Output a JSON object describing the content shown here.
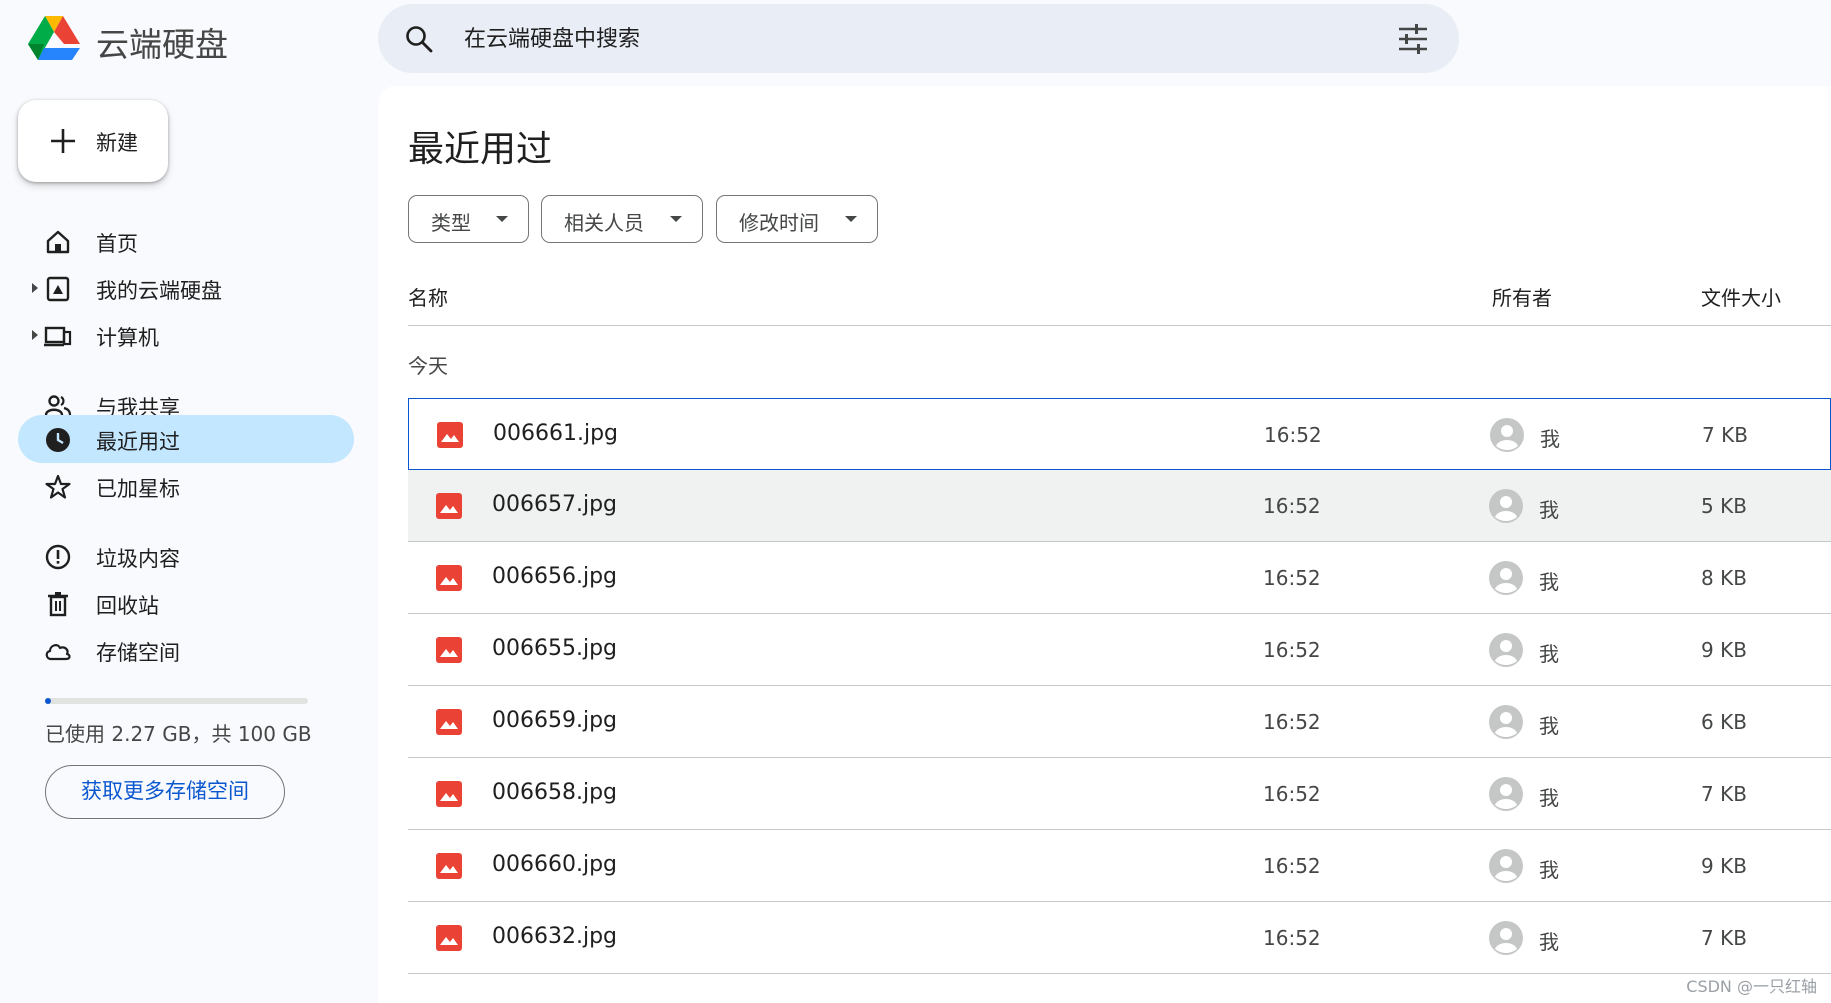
{
  "app": {
    "title": "云端硬盘"
  },
  "search": {
    "placeholder": "在云端硬盘中搜索"
  },
  "new_button": {
    "label": "新建"
  },
  "sidebar": {
    "items": [
      {
        "label": "首页",
        "icon": "home-icon"
      },
      {
        "label": "我的云端硬盘",
        "icon": "my-drive-icon"
      },
      {
        "label": "计算机",
        "icon": "computer-icon"
      },
      {
        "label": "与我共享",
        "icon": "people-icon"
      },
      {
        "label": "最近用过",
        "icon": "clock-icon",
        "active": true
      },
      {
        "label": "已加星标",
        "icon": "star-icon"
      },
      {
        "label": "垃圾内容",
        "icon": "spam-icon"
      },
      {
        "label": "回收站",
        "icon": "trash-icon"
      },
      {
        "label": "存储空间",
        "icon": "cloud-icon"
      }
    ],
    "storage": {
      "used_text": "已使用 2.27 GB，共 100 GB",
      "fraction": 0.0227,
      "button": "获取更多存储空间"
    }
  },
  "main": {
    "title": "最近用过",
    "filters": [
      "类型",
      "相关人员",
      "修改时间"
    ],
    "columns": {
      "name": "名称",
      "owner": "所有者",
      "size": "文件大小"
    },
    "group": "今天",
    "files": [
      {
        "name": "006661.jpg",
        "time": "16:52",
        "owner": "我",
        "size": "7 KB"
      },
      {
        "name": "006657.jpg",
        "time": "16:52",
        "owner": "我",
        "size": "5 KB"
      },
      {
        "name": "006656.jpg",
        "time": "16:52",
        "owner": "我",
        "size": "8 KB"
      },
      {
        "name": "006655.jpg",
        "time": "16:52",
        "owner": "我",
        "size": "9 KB"
      },
      {
        "name": "006659.jpg",
        "time": "16:52",
        "owner": "我",
        "size": "6 KB"
      },
      {
        "name": "006658.jpg",
        "time": "16:52",
        "owner": "我",
        "size": "7 KB"
      },
      {
        "name": "006660.jpg",
        "time": "16:52",
        "owner": "我",
        "size": "9 KB"
      },
      {
        "name": "006632.jpg",
        "time": "16:52",
        "owner": "我",
        "size": "7 KB"
      }
    ]
  },
  "watermark": "CSDN @一只红轴",
  "colors": {
    "accent": "#0b57d0",
    "active_nav": "#c2e7ff",
    "image_icon": "#ea4335"
  }
}
